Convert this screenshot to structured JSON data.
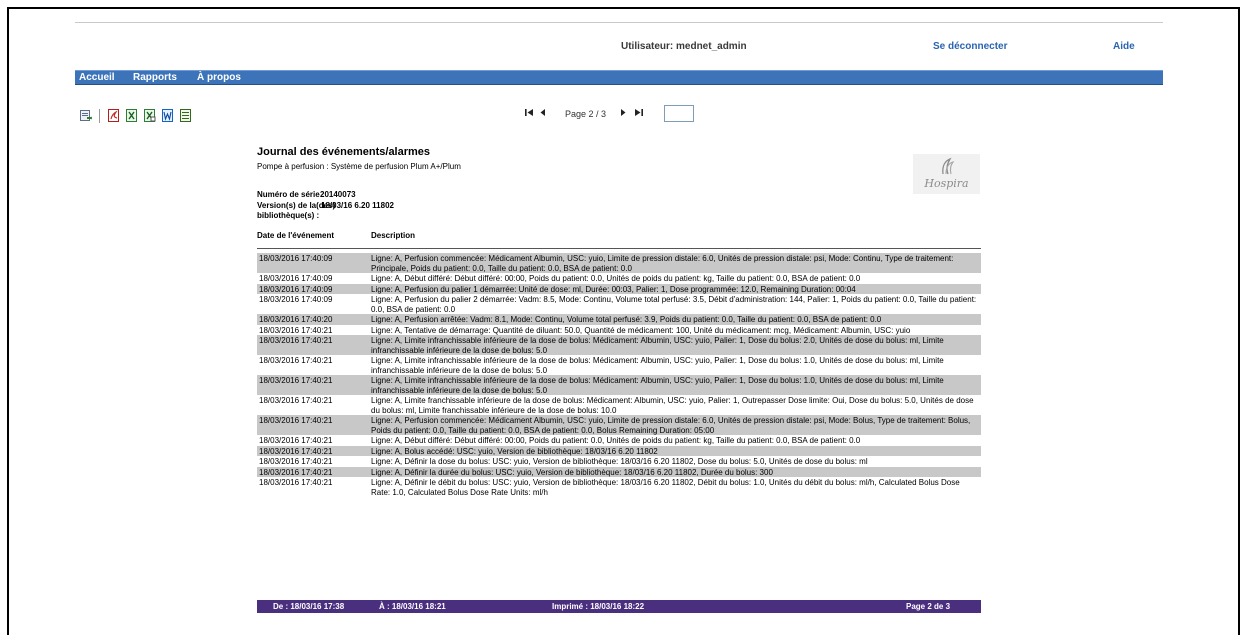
{
  "header": {
    "user_label": "Utilisateur: mednet_admin",
    "logout": "Se déconnecter",
    "help": "Aide"
  },
  "menu": [
    "Accueil",
    "Rapports",
    "À propos"
  ],
  "toolbar": {
    "icons": [
      "export-icon",
      "pdf-icon",
      "excel-icon",
      "excel-data-icon",
      "word-icon",
      "csv-icon"
    ]
  },
  "pager": {
    "first": "⏮",
    "prev": "◀",
    "next": "▶",
    "last": "⏭",
    "indicator": "Page 2 / 3",
    "input_value": ""
  },
  "report": {
    "title": "Journal des événements/alarmes",
    "pump_line": "Pompe à perfusion : Système de perfusion Plum A+/Plum",
    "serial_label": "Numéro de série :",
    "serial_value": "20140073",
    "version_label": "Version(s) de la(des) bibliothèque(s) :",
    "version_value": "18/03/16 6.20 11802",
    "logo": "Hospira",
    "columns": {
      "date": "Date de l'événement",
      "description": "Description"
    },
    "rows": [
      {
        "date": "18/03/2016 17:40:09",
        "text": "Ligne: A, Perfusion commencée: Médicament Albumin, USC: yuio, Limite de pression distale: 6.0, Unités de pression distale: psi, Mode: Continu, Type de traitement: Principale, Poids du patient: 0.0, Taille du patient: 0.0, BSA de patient: 0.0",
        "shaded": true
      },
      {
        "date": "18/03/2016 17:40:09",
        "text": "Ligne: A, Début différé: Début différé: 00:00, Poids du patient: 0.0, Unités de poids du patient: kg, Taille du patient: 0.0, BSA de patient: 0.0",
        "shaded": false
      },
      {
        "date": "18/03/2016 17:40:09",
        "text": "Ligne: A, Perfusion du palier 1 démarrée: Unité de dose: ml, Durée: 00:03, Palier: 1, Dose programmée: 12.0, Remaining Duration: 00:04",
        "shaded": true
      },
      {
        "date": "18/03/2016 17:40:09",
        "text": "Ligne: A, Perfusion du palier 2 démarrée: Vadm: 8.5, Mode: Continu, Volume total perfusé: 3.5, Débit d'administration: 144, Palier: 1, Poids du patient: 0.0, Taille du patient: 0.0, BSA de patient: 0.0",
        "shaded": false
      },
      {
        "date": "18/03/2016 17:40:20",
        "text": "Ligne: A, Perfusion arrêtée: Vadm: 8.1, Mode: Continu, Volume total perfusé: 3.9, Poids du patient: 0.0, Taille du patient: 0.0, BSA de patient: 0.0",
        "shaded": true
      },
      {
        "date": "18/03/2016 17:40:21",
        "text": "Ligne: A, Tentative de démarrage: Quantité de diluant: 50.0, Quantité de médicament: 100, Unité du médicament: mcg, Médicament: Albumin, USC: yuio",
        "shaded": false
      },
      {
        "date": "18/03/2016 17:40:21",
        "text": "Ligne: A, Limite infranchissable inférieure de la dose de bolus: Médicament: Albumin, USC: yuio, Palier: 1, Dose du bolus: 2.0, Unités de dose du bolus: ml, Limite infranchissable inférieure de la dose de bolus: 5.0",
        "shaded": true
      },
      {
        "date": "18/03/2016 17:40:21",
        "text": "Ligne: A, Limite infranchissable inférieure de la dose de bolus: Médicament: Albumin, USC: yuio, Palier: 1, Dose du bolus: 1.0, Unités de dose du bolus: ml, Limite infranchissable inférieure de la dose de bolus: 5.0",
        "shaded": false
      },
      {
        "date": "18/03/2016 17:40:21",
        "text": "Ligne: A, Limite infranchissable inférieure de la dose de bolus: Médicament: Albumin, USC: yuio, Palier: 1, Dose du bolus: 1.0, Unités de dose du bolus: ml, Limite infranchissable inférieure de la dose de bolus: 5.0",
        "shaded": true
      },
      {
        "date": "18/03/2016 17:40:21",
        "text": "Ligne: A, Limite franchissable inférieure de la dose de bolus: Médicament: Albumin, USC: yuio, Palier: 1, Outrepasser Dose limite: Oui, Dose du bolus: 5.0, Unités de dose du bolus: ml, Limite franchissable inférieure de la dose de bolus: 10.0",
        "shaded": false
      },
      {
        "date": "18/03/2016 17:40:21",
        "text": "Ligne: A, Perfusion commencée: Médicament Albumin, USC: yuio, Limite de pression distale: 6.0, Unités de pression distale: psi, Mode: Bolus, Type de traitement: Bolus, Poids du patient: 0.0, Taille du patient: 0.0, BSA de patient: 0.0, Bolus Remaining Duration: 05:00",
        "shaded": true
      },
      {
        "date": "18/03/2016 17:40:21",
        "text": "Ligne: A, Début différé: Début différé: 00:00, Poids du patient: 0.0, Unités de poids du patient: kg, Taille du patient: 0.0, BSA de patient: 0.0",
        "shaded": false
      },
      {
        "date": "18/03/2016 17:40:21",
        "text": "Ligne: A, Bolus accédé: USC: yuio, Version de bibliothèque: 18/03/16 6.20 11802",
        "shaded": true
      },
      {
        "date": "18/03/2016 17:40:21",
        "text": "Ligne: A, Définir la dose du bolus: USC: yuio, Version de bibliothèque: 18/03/16 6.20 11802, Dose du bolus: 5.0, Unités de dose du bolus: ml",
        "shaded": false
      },
      {
        "date": "18/03/2016 17:40:21",
        "text": "Ligne: A, Définir la durée du bolus: USC: yuio, Version de bibliothèque: 18/03/16 6.20 11802, Durée du bolus: 300",
        "shaded": true
      },
      {
        "date": "18/03/2016 17:40:21",
        "text": "Ligne: A, Définir le débit du bolus: USC: yuio, Version de bibliothèque: 18/03/16 6.20 11802, Débit du bolus: 1.0, Unités du débit du bolus: ml/h, Calculated Bolus Dose Rate: 1.0, Calculated Bolus Dose Rate Units: ml/h",
        "shaded": false
      }
    ],
    "footer": {
      "from": "De : 18/03/16 17:38",
      "to": "À : 18/03/16 18:21",
      "printed": "Imprimé : 18/03/16 18:22",
      "page": "Page 2 de 3"
    }
  },
  "colors": {
    "menubar": "#3d74b9",
    "footer": "#4b2f7f",
    "row_shade": "#c8c8c8",
    "link": "#2b64b0"
  }
}
